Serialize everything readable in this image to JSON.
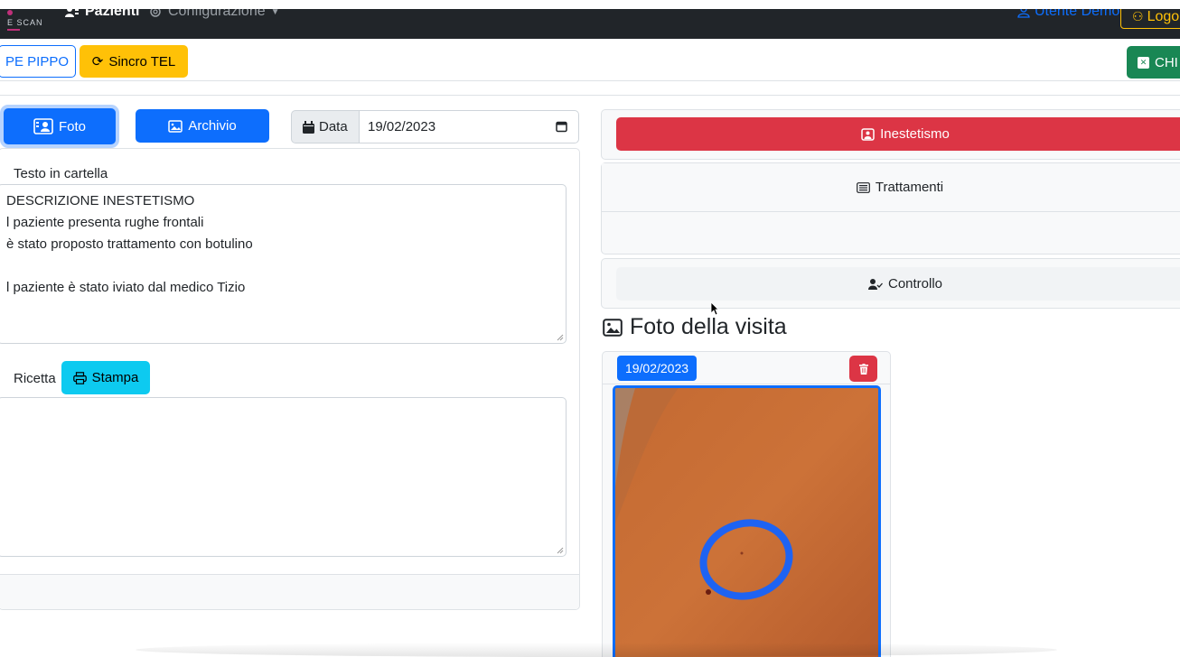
{
  "navbar": {
    "brand": "E SCAN",
    "items": [
      {
        "label": "Pazienti",
        "icon": "user-group-icon"
      },
      {
        "label": "Configurazione",
        "icon": "gear-icon"
      }
    ],
    "user": "Utente Demo",
    "logout": "Logo"
  },
  "toolbar": {
    "patient_button": "PE PIPPO",
    "sync_button": "Sincro TEL",
    "close_button": "CHI"
  },
  "left": {
    "foto_button": "Foto",
    "archivio_button": "Archivio",
    "date_label": "Data",
    "date_value": "19/02/2023",
    "testo_label": "Testo in cartella",
    "testo_lines": [
      "DESCRIZIONE INESTETISMO",
      "l paziente presenta rughe frontali",
      "è stato proposto trattamento con botulino",
      "",
      "l paziente è stato iviato dal medico Tizio"
    ],
    "ricetta_label": "Ricetta",
    "stampa_button": "Stampa"
  },
  "right": {
    "inestetismo": "Inestetismo",
    "trattamenti": "Trattamenti",
    "controllo": "Controllo",
    "photos_title": "Foto della visita",
    "photo_date": "19/02/2023"
  },
  "colors": {
    "primary": "#0d6efd",
    "danger": "#dc3545",
    "warning": "#ffc107",
    "success": "#198754",
    "info": "#0dcaf0",
    "navbar": "#212529"
  }
}
